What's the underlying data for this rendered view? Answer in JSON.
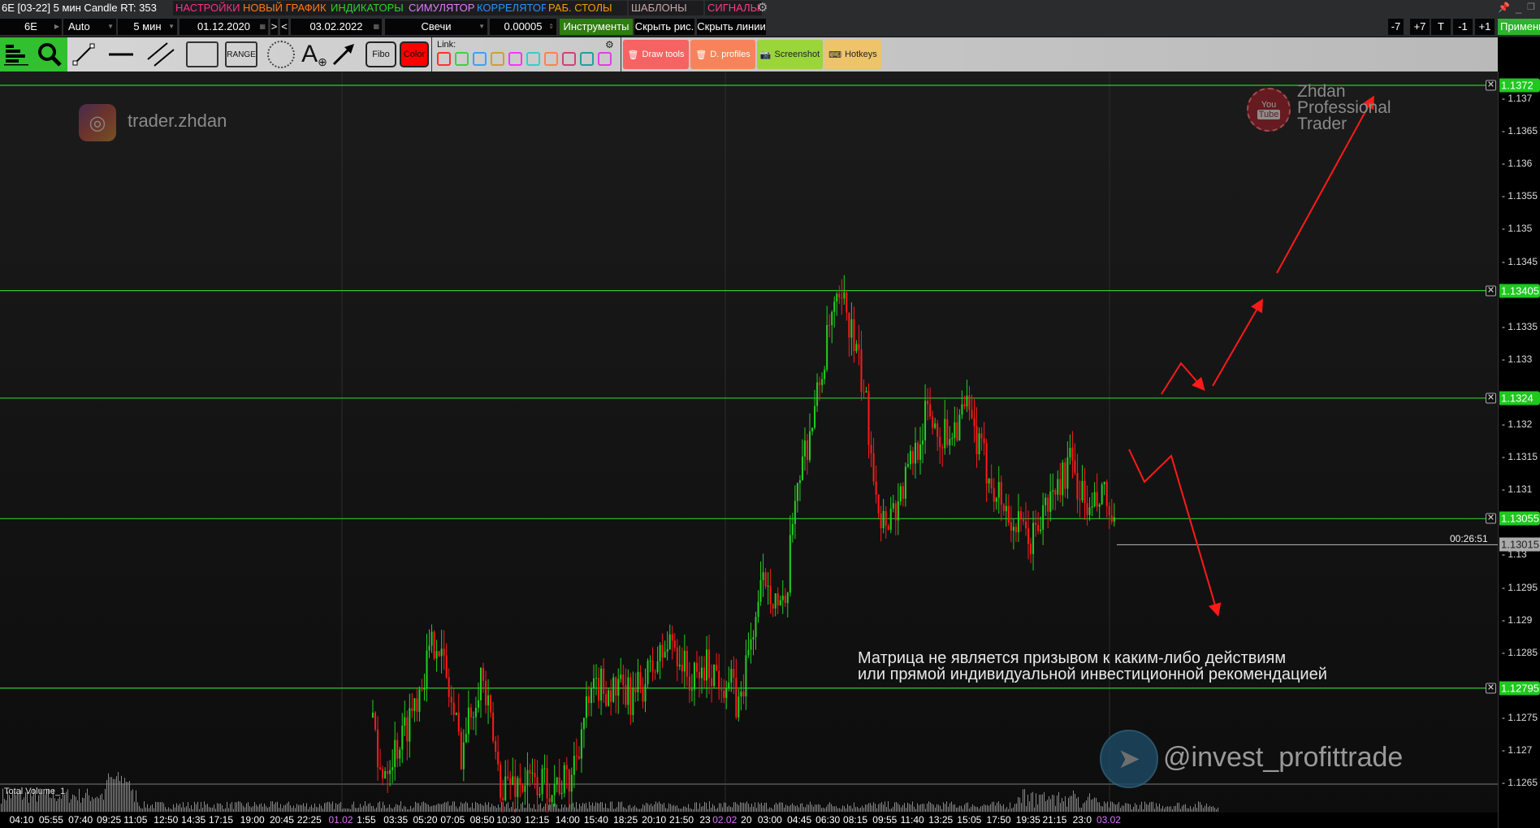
{
  "title": "6E [03-22] 5 мин Candle RT: 353",
  "menu": [
    {
      "label": "НАСТРОЙКИ",
      "color": "#ff2d8a"
    },
    {
      "label": "НОВЫЙ ГРАФИК",
      "color": "#ff7a1a"
    },
    {
      "label": "ИНДИКАТОРЫ",
      "color": "#2bd42b"
    },
    {
      "label": "СИМУЛЯТОР",
      "color": "#e07cff"
    },
    {
      "label": "КОРРЕЛЯТОР",
      "color": "#2a90ff"
    },
    {
      "label": "РАБ. СТОЛЫ",
      "color": "#f0a000"
    },
    {
      "label": "ШАБЛОНЫ",
      "color": "#c9a8a8"
    },
    {
      "label": "СИГНАЛЫ",
      "color": "#ff3a8a"
    }
  ],
  "controls": {
    "symbol": "6E",
    "scale": "Auto",
    "timeframe": "5 мин",
    "date_from": "01.12.2020",
    "next": ">",
    "prev": "<",
    "date_to": "03.02.2022",
    "chart_type": "Свечи",
    "tick_size": "0.00005",
    "instruments": "Инструменты",
    "hide_drawings": "Скрыть рис.",
    "hide_lines": "Скрыть линии"
  },
  "right_buttons": [
    "-7",
    "+7",
    "T",
    "-1",
    "+1"
  ],
  "apply": "Применить",
  "toolbar": {
    "range": "RANGE",
    "fibo": "Fibo",
    "color": "Color",
    "link": "Link:",
    "draw_tools": "Draw tools",
    "d_profiles": "D. profiles",
    "screenshot": "Screenshot",
    "hotkeys": "Hotkeys"
  },
  "link_colors": [
    "#ff3030",
    "#40d040",
    "#3aa0ff",
    "#d0a030",
    "#ff30ff",
    "#30d0d0",
    "#ff8050",
    "#d04080",
    "#20a0a0",
    "#e040e0"
  ],
  "watermarks": {
    "instagram": "trader.zhdan",
    "youtube_line1": "Zhdan",
    "youtube_line2": "Professional",
    "youtube_line3": "Trader",
    "youtube_badge_1": "You",
    "youtube_badge_2": "Tube",
    "telegram": "@invest_profittrade"
  },
  "disclaimer": {
    "line1": "Матрица не является призывом к каким-либо действиям",
    "line2": "или прямой индивидуальной инвестиционной рекомендацией"
  },
  "volume_label": "Total Volume_1",
  "timer": "00:26:51",
  "current_price": "1.13015",
  "chart_data": {
    "type": "candlestick",
    "symbol": "6E [03-22]",
    "timeframe": "5 мин",
    "ylim": [
      1.12625,
      1.13745
    ],
    "price_ticks": [
      "1.137",
      "1.1365",
      "1.136",
      "1.1355",
      "1.135",
      "1.1345",
      "1.1335",
      "1.133",
      "1.132",
      "1.1315",
      "1.131",
      "1.13",
      "1.1295",
      "1.129",
      "1.1285",
      "1.1275",
      "1.127",
      "1.1265"
    ],
    "levels": [
      "1.1372",
      "1.13405",
      "1.1324",
      "1.13055",
      "1.12795"
    ],
    "time_labels": [
      "04:10",
      "05:55",
      "07:40",
      "09:25",
      "11:05",
      "12:50",
      "14:35",
      "17:15",
      "19:00",
      "20:45",
      "22:25",
      "01.02",
      "1:55",
      "03:35",
      "05:20",
      "07:05",
      "08:50",
      "10:30",
      "12:15",
      "14:00",
      "15:40",
      "18:25",
      "20:10",
      "21:50",
      "23",
      "02.02",
      "20",
      "03:00",
      "04:45",
      "06:30",
      "08:15",
      "09:55",
      "11:40",
      "13:25",
      "15:05",
      "17:50",
      "19:35",
      "21:15",
      "23:0",
      "03.02"
    ],
    "date_labels": [
      "01.02",
      "02.02",
      "03.02"
    ],
    "price_path": [
      [
        0,
        1.1275
      ],
      [
        5,
        1.1266
      ],
      [
        30,
        1.1272
      ],
      [
        65,
        1.1288
      ],
      [
        90,
        1.127
      ],
      [
        110,
        1.1282
      ],
      [
        130,
        1.1265
      ],
      [
        200,
        1.1265
      ],
      [
        215,
        1.1275
      ],
      [
        230,
        1.128
      ],
      [
        265,
        1.1278
      ],
      [
        305,
        1.1287
      ],
      [
        325,
        1.128
      ],
      [
        340,
        1.1283
      ],
      [
        365,
        1.128
      ],
      [
        372,
        1.1276
      ],
      [
        385,
        1.1287
      ],
      [
        400,
        1.1297
      ],
      [
        420,
        1.129
      ],
      [
        430,
        1.131
      ],
      [
        450,
        1.1322
      ],
      [
        468,
        1.1337
      ],
      [
        482,
        1.1338
      ],
      [
        500,
        1.1325
      ],
      [
        518,
        1.1305
      ],
      [
        535,
        1.1308
      ],
      [
        565,
        1.1322
      ],
      [
        580,
        1.1318
      ],
      [
        605,
        1.1322
      ],
      [
        620,
        1.1315
      ],
      [
        650,
        1.1305
      ],
      [
        670,
        1.1302
      ],
      [
        685,
        1.1307
      ],
      [
        710,
        1.1314
      ],
      [
        730,
        1.1306
      ],
      [
        745,
        1.1309
      ],
      [
        757,
        1.13015
      ]
    ]
  }
}
